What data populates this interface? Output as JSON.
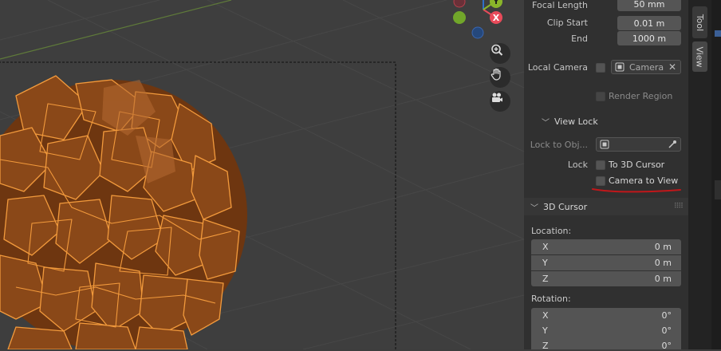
{
  "camera": {
    "focal_length_label": "Focal Length",
    "focal_length_value": "50 mm",
    "clip_start_label": "Clip Start",
    "clip_start_value": "0.01 m",
    "clip_end_label": "End",
    "clip_end_value": "1000 m",
    "local_camera_label": "Local Camera",
    "local_camera_value": "Camera",
    "render_region_label": "Render Region"
  },
  "view_lock": {
    "title": "View Lock",
    "lock_to_object_label": "Lock to Obj...",
    "lock_label": "Lock",
    "to_3d_cursor_label": "To 3D Cursor",
    "camera_to_view_label": "Camera to View"
  },
  "cursor_3d": {
    "title": "3D Cursor",
    "location_label": "Location:",
    "location": [
      {
        "axis": "X",
        "value": "0 m"
      },
      {
        "axis": "Y",
        "value": "0 m"
      },
      {
        "axis": "Z",
        "value": "0 m"
      }
    ],
    "rotation_label": "Rotation:",
    "rotation": [
      {
        "axis": "X",
        "value": "0°"
      },
      {
        "axis": "Y",
        "value": "0°"
      },
      {
        "axis": "Z",
        "value": "0°"
      }
    ]
  },
  "gizmo": {
    "x_label": "X",
    "y_label": "Y"
  },
  "tabs": {
    "tool": "Tool",
    "view": "View"
  },
  "colors": {
    "selection_outline": "#f29a3c",
    "object_fill": "#7a3c12",
    "annotation_underline": "#c0171a",
    "axis_x": "#e84b5a",
    "axis_y": "#8ab52a",
    "axis_z": "#2f6fc8"
  }
}
